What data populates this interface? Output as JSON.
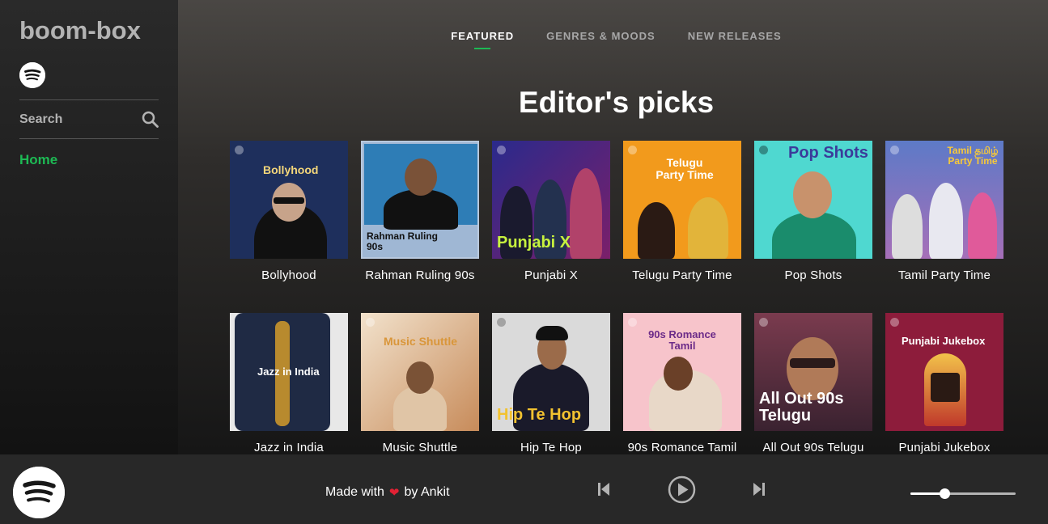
{
  "app": {
    "title": "boom-box"
  },
  "sidebar": {
    "logo_icon": "spotify-icon",
    "search_label": "Search",
    "search_icon": "search-icon",
    "home_label": "Home"
  },
  "tabs": [
    {
      "label": "FEATURED",
      "active": true
    },
    {
      "label": "GENRES & MOODS",
      "active": false
    },
    {
      "label": "NEW RELEASES",
      "active": false
    }
  ],
  "heading": "Editor's picks",
  "playlists": [
    {
      "title": "Bollyhood",
      "cover_text": "Bollyhood",
      "bg": "#1e2f5c"
    },
    {
      "title": "Rahman Ruling 90s",
      "cover_text": "Rahman Ruling 90s",
      "bg": "#9fb7d4"
    },
    {
      "title": "Punjabi X",
      "cover_text": "Punjabi X",
      "bg": "#3a2a86"
    },
    {
      "title": "Telugu Party Time",
      "cover_text": "Telugu Party Time",
      "bg": "#f0a020"
    },
    {
      "title": "Pop Shots",
      "cover_text": "Pop Shots",
      "bg": "#4dd5cf"
    },
    {
      "title": "Tamil Party Time",
      "cover_text": "Tamil தமிழ் Party Time",
      "bg": "#6d63b8"
    },
    {
      "title": "Jazz in India",
      "cover_text": "Jazz in India",
      "bg": "#e6e6e6"
    },
    {
      "title": "Music Shuttle",
      "cover_text": "Music Shuttle",
      "bg": "#e9d6c0"
    },
    {
      "title": "Hip Te Hop",
      "cover_text": "Hip Te Hop",
      "bg": "#d8d8d8"
    },
    {
      "title": "90s Romance Tamil",
      "cover_text": "90s Romance Tamil",
      "bg": "#f6c6cc"
    },
    {
      "title": "All Out 90s Telugu",
      "cover_text": "All Out 90s Telugu",
      "bg": "#6b3a4a"
    },
    {
      "title": "Punjabi Jukebox",
      "cover_text": "Punjabi Jukebox",
      "bg": "#8e1d3c"
    }
  ],
  "footer": {
    "logo_icon": "spotify-icon",
    "made_with": "Made with",
    "by": "by Ankit",
    "heart_icon": "heart-icon",
    "prev_icon": "skip-previous-icon",
    "play_icon": "play-icon",
    "next_icon": "skip-next-icon",
    "volume_level": 0.32
  },
  "colors": {
    "accent": "#1db954",
    "footer_bg": "#282828",
    "sidebar_bg": "#121212"
  }
}
